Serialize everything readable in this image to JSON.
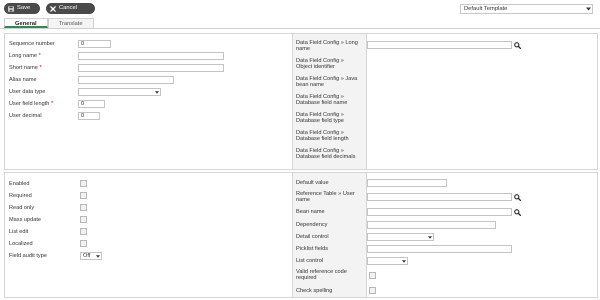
{
  "toolbar": {
    "save_label": "Save",
    "cancel_label": "Cancel",
    "template_value": "Default Template"
  },
  "tabs": [
    {
      "label": "General",
      "active": true
    },
    {
      "label": "Translate",
      "active": false
    }
  ],
  "general_left": {
    "sequence_number": {
      "label": "Sequence number",
      "value": "0"
    },
    "long_name": {
      "label": "Long name",
      "required": "*"
    },
    "short_name": {
      "label": "Short name",
      "required": "*"
    },
    "alias_name": {
      "label": "Alias name"
    },
    "user_data_type": {
      "label": "User data type"
    },
    "user_field_length": {
      "label": "User field length",
      "required": "*",
      "value": "0"
    },
    "user_decimal": {
      "label": "User decimal",
      "value": "0"
    }
  },
  "general_right": {
    "long_name_config": "Data Field Config » Long name",
    "object_identifier_config": "Data Field Config » Object identifier",
    "java_bean_name_config": "Data Field Config » Java bean name",
    "database_field_name_config": "Data Field Config » Database field name",
    "database_field_type_config": "Data Field Config » Database field type",
    "database_field_length_config": "Data Field Config » Database field length",
    "database_field_decimals_config": "Data Field Config » Database field decimals"
  },
  "bottom_left": {
    "enabled": "Enabled",
    "required": "Required",
    "read_only": "Read only",
    "mass_update": "Mass update",
    "list_edit": "List edit",
    "localized": "Localized",
    "field_audit_type": {
      "label": "Field audit type",
      "value": "Off"
    }
  },
  "bottom_right": {
    "default_value": "Default value",
    "reference_table_user_name": "Reference Table » User name",
    "bean_name": "Bean name",
    "dependency": "Dependency",
    "detail_control": "Detail control",
    "picklist_fields": "Picklist fields",
    "list_control": "List control",
    "valid_reference_code_required": "Valid reference code required",
    "check_spelling": "Check spelling"
  },
  "colors": {
    "button_bg": "#4a4a4a",
    "tab_active_underline": "#2e8b57",
    "required_mark": "#cc0000",
    "label_column_bg": "#f3f3f3"
  },
  "icons": {
    "save": "floppy-disk-icon",
    "cancel": "close-x-icon",
    "search": "magnifier-icon",
    "dropdown": "caret-down-icon"
  }
}
